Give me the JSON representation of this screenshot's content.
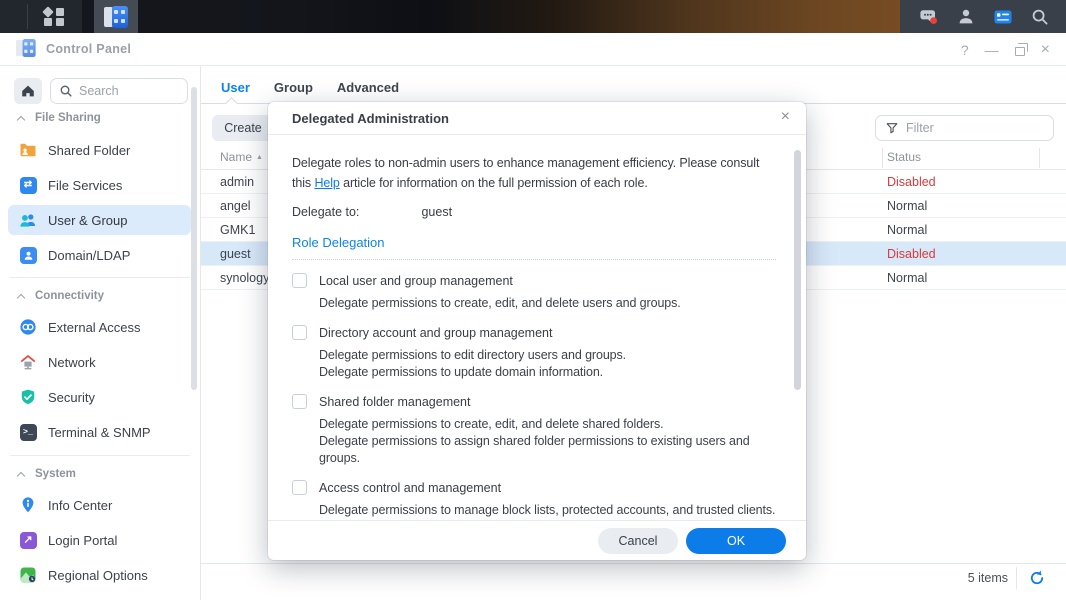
{
  "colors": {
    "accent_blue": "#0c7ce8",
    "link_blue": "#0b7ce8",
    "status_disabled_red": "#d93a3c",
    "selected_row_bg": "#d7e8f9",
    "sidebar_selected_bg": "#dcebfc",
    "notification_badge": "#e8413d"
  },
  "topbar": {
    "icons": [
      "apps-grid",
      "control-panel-app",
      "chat-notification",
      "user-account",
      "widgets-panel",
      "search"
    ]
  },
  "window": {
    "title": "Control Panel",
    "controls": {
      "help": "?",
      "minimize": "—",
      "close": "×"
    }
  },
  "sidebar": {
    "search_placeholder": "Search",
    "sections": [
      {
        "label": "File Sharing",
        "items": [
          {
            "label": "Shared Folder",
            "icon": "shared-folder",
            "selected": false
          },
          {
            "label": "File Services",
            "icon": "file-services",
            "selected": false
          },
          {
            "label": "User & Group",
            "icon": "user-group",
            "selected": true
          },
          {
            "label": "Domain/LDAP",
            "icon": "domain-ldap",
            "selected": false
          }
        ]
      },
      {
        "label": "Connectivity",
        "items": [
          {
            "label": "External Access",
            "icon": "external-access",
            "selected": false
          },
          {
            "label": "Network",
            "icon": "network",
            "selected": false
          },
          {
            "label": "Security",
            "icon": "security-shield",
            "selected": false
          },
          {
            "label": "Terminal & SNMP",
            "icon": "terminal",
            "selected": false
          }
        ]
      },
      {
        "label": "System",
        "items": [
          {
            "label": "Info Center",
            "icon": "info-pin",
            "selected": false
          },
          {
            "label": "Login Portal",
            "icon": "login-portal",
            "selected": false
          },
          {
            "label": "Regional Options",
            "icon": "regional-options",
            "selected": false
          }
        ]
      }
    ]
  },
  "main": {
    "tabs": [
      {
        "label": "User",
        "active": true
      },
      {
        "label": "Group",
        "active": false
      },
      {
        "label": "Advanced",
        "active": false
      }
    ],
    "toolbar": {
      "create_label": "Create",
      "filter_placeholder": "Filter"
    },
    "table": {
      "columns": [
        "Name",
        "Status"
      ],
      "sort_indicator": "▲",
      "rows": [
        {
          "name": "admin",
          "status": "Disabled",
          "selected": false
        },
        {
          "name": "angel",
          "status": "Normal",
          "selected": false
        },
        {
          "name": "GMK1",
          "status": "Normal",
          "selected": false
        },
        {
          "name": "guest",
          "status": "Disabled",
          "selected": true
        },
        {
          "name": "synology",
          "status": "Normal",
          "selected": false
        }
      ]
    },
    "footer": {
      "items_label": "5 items"
    }
  },
  "dialog": {
    "title": "Delegated Administration",
    "close_glyph": "×",
    "intro_before": "Delegate roles to non-admin users to enhance management efficiency. Please consult this ",
    "help_link": "Help",
    "intro_after": " article for information on the full permission of each role.",
    "delegate_label": "Delegate to:",
    "delegate_value": "guest",
    "section_title": "Role Delegation",
    "roles": [
      {
        "label": "Local user and group management",
        "desc": [
          "Delegate permissions to create, edit, and delete users and groups."
        ]
      },
      {
        "label": "Directory account and group management",
        "desc": [
          "Delegate permissions to edit directory users and groups.",
          "Delegate permissions to update domain information."
        ]
      },
      {
        "label": "Shared folder management",
        "desc": [
          "Delegate permissions to create, edit, and delete shared folders.",
          "Delegate permissions to assign shared folder permissions to existing users and groups."
        ]
      },
      {
        "label": "Access control and management",
        "desc": [
          "Delegate permissions to manage block lists, protected accounts, and trusted clients."
        ]
      }
    ],
    "cancel_label": "Cancel",
    "ok_label": "OK"
  }
}
